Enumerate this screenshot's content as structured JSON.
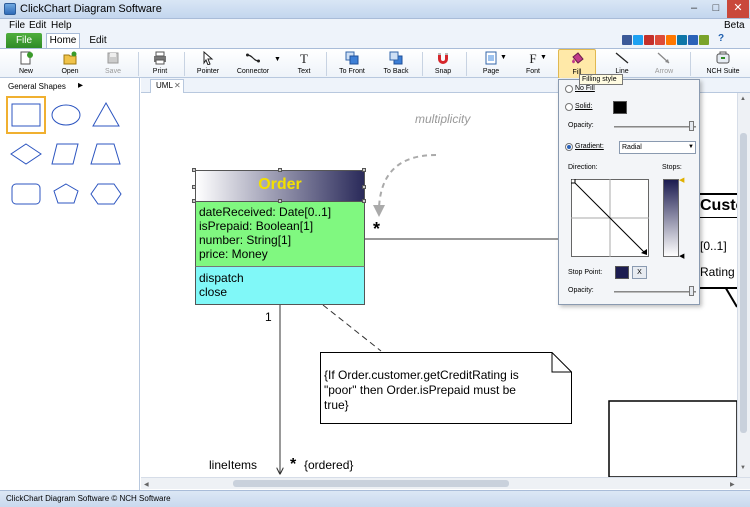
{
  "window": {
    "title": "ClickChart Diagram Software",
    "beta": "Beta",
    "min": "–",
    "max": "□",
    "close": "✕"
  },
  "menu": [
    "File",
    "Edit",
    "Help"
  ],
  "ribbon_tabs": {
    "file": "File",
    "home": "Home",
    "edit": "Edit"
  },
  "social_colors": [
    "#3b5998",
    "#1da1f2",
    "#c4302b",
    "#dd4b39",
    "#ff7700",
    "#0e76a8",
    "#2b62b8",
    "#7aa32a"
  ],
  "help": "?",
  "toolbar": [
    {
      "label": "New",
      "icon": "new-icon",
      "disabled": false
    },
    {
      "label": "Open",
      "icon": "open-icon",
      "disabled": false
    },
    {
      "label": "Save",
      "icon": "save-icon",
      "disabled": true
    },
    {
      "label": "Print",
      "icon": "print-icon",
      "disabled": false
    },
    {
      "label": "Pointer",
      "icon": "pointer-icon",
      "disabled": false
    },
    {
      "label": "Connector",
      "icon": "connector-icon",
      "disabled": false
    },
    {
      "label": "Text",
      "icon": "text-icon",
      "disabled": false
    },
    {
      "label": "To Front",
      "icon": "to-front-icon",
      "disabled": false
    },
    {
      "label": "To Back",
      "icon": "to-back-icon",
      "disabled": false
    },
    {
      "label": "Snap",
      "icon": "snap-icon",
      "disabled": false
    },
    {
      "label": "Page",
      "icon": "page-icon",
      "disabled": false
    },
    {
      "label": "Font",
      "icon": "font-icon",
      "disabled": false
    },
    {
      "label": "Fill",
      "icon": "fill-icon",
      "disabled": false
    },
    {
      "label": "Line",
      "icon": "line-icon",
      "disabled": false
    },
    {
      "label": "Arrow",
      "icon": "arrow-icon",
      "disabled": true
    },
    {
      "label": "NCH Suite",
      "icon": "nch-suite-icon",
      "disabled": false
    }
  ],
  "shapes_panel": {
    "header": "General Shapes",
    "arrow": "▸"
  },
  "doc_tab": {
    "label": "UML",
    "close": "✕"
  },
  "statusbar": "ClickChart Diagram Software © NCH Software",
  "fill_tooltip": "Filling style",
  "fill_panel": {
    "no_fill": "No Fill",
    "solid": "Solid:",
    "opacity": "Opacity:",
    "gradient": "Gradient:",
    "gradient_type": "Radial",
    "direction": "Direction:",
    "stops": "Stops:",
    "stop_point": "Stop Point:",
    "remove_stop": "X",
    "solid_color": "#000000",
    "gradient_from": "#ffffff",
    "gradient_to": "#1c1c50"
  },
  "diagram": {
    "order": {
      "title": "Order",
      "attributes": [
        "dateReceived: Date[0..1]",
        "isPrepaid: Boolean[1]",
        "number: String[1]",
        "price: Money"
      ],
      "operations": [
        "dispatch",
        "close"
      ]
    },
    "multiplicity_label": "multiplicity",
    "star1": "*",
    "one": "1",
    "note_lines": [
      "{If Order.customer.getCreditRating is",
      "\"poor\" then Order.isPrepaid must be",
      "true}"
    ],
    "line_items": "lineItems",
    "star2": "*",
    "ordered": "{ordered}",
    "customer_partial": {
      "title": "Custo",
      "row1": "[0..1]",
      "row2": "Rating"
    }
  }
}
